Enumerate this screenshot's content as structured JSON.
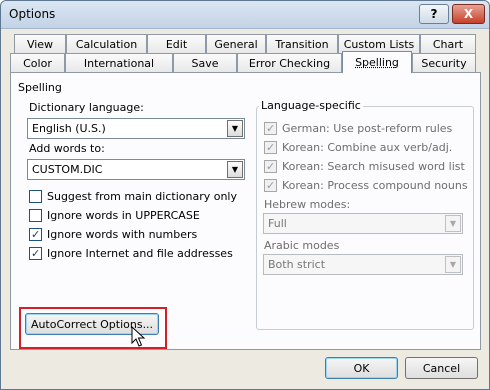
{
  "window": {
    "title": "Options",
    "help_label": "?",
    "close_label": "X"
  },
  "tabs_row1": [
    "View",
    "Calculation",
    "Edit",
    "General",
    "Transition",
    "Custom Lists",
    "Chart"
  ],
  "tabs_row2": [
    "Color",
    "International",
    "Save",
    "Error Checking",
    "Spelling",
    "Security"
  ],
  "active_tab": "Spelling",
  "section_title": "Spelling",
  "dictionary": {
    "label": "Dictionary language:",
    "value": "English (U.S.)"
  },
  "add_words": {
    "label": "Add words to:",
    "value": "CUSTOM.DIC"
  },
  "options": [
    {
      "label": "Suggest from main dictionary only",
      "checked": false
    },
    {
      "label": "Ignore words in UPPERCASE",
      "checked": false
    },
    {
      "label": "Ignore words with numbers",
      "checked": true
    },
    {
      "label": "Ignore Internet and file addresses",
      "checked": true
    }
  ],
  "language_specific": {
    "title": "Language-specific",
    "options": [
      {
        "label": "German: Use post-reform rules",
        "checked": true
      },
      {
        "label": "Korean: Combine aux verb/adj.",
        "checked": true
      },
      {
        "label": "Korean: Search misused word list",
        "checked": true
      },
      {
        "label": "Korean: Process compound nouns",
        "checked": true
      }
    ],
    "hebrew": {
      "label": "Hebrew modes:",
      "value": "Full"
    },
    "arabic": {
      "label": "Arabic modes",
      "value": "Both strict"
    }
  },
  "autocorrect_button": "AutoCorrect Options...",
  "ok_button": "OK",
  "cancel_button": "Cancel",
  "colors": {
    "highlight": "#d32025",
    "accent": "#3c7fb1"
  }
}
